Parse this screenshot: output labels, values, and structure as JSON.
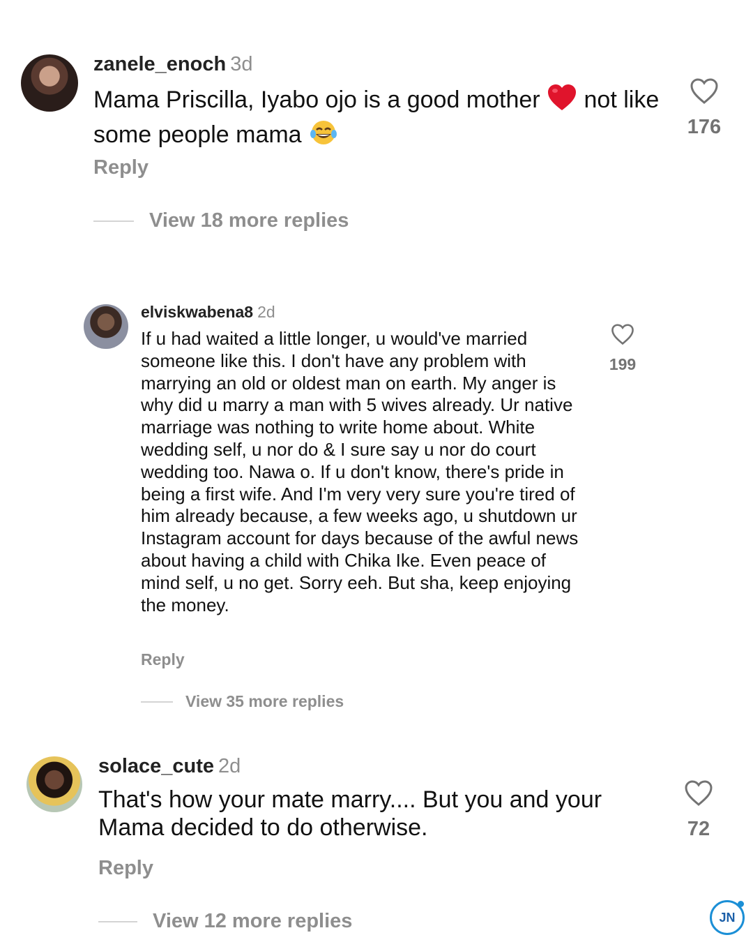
{
  "comments": [
    {
      "username": "zanele_enoch",
      "time": "3d",
      "text_before": "Mama Priscilla, Iyabo ojo is a good mother ",
      "text_after_heart": " not like some people mama ",
      "emoji_heart": "red-heart",
      "emoji_laugh": "tears-of-joy",
      "reply": "Reply",
      "likes": "176",
      "view_more": "View 18 more replies"
    },
    {
      "username": "elviskwabena8",
      "time": "2d",
      "text": "If u had waited a little longer, u would've married someone like this. I don't have any problem with marrying an old or oldest man on earth. My anger is why did u marry a man with 5 wives already. Ur native marriage was nothing to write home about. White wedding self, u nor do & I sure say u nor do court wedding too. Nawa o. If u don't know, there's pride in being a first wife. And I'm very very sure you're tired of him already because, a few weeks ago, u shutdown ur Instagram account for days because of the awful news about having a child with Chika Ike. Even peace of mind self, u no get. Sorry eeh. But sha, keep enjoying the money.",
      "reply": "Reply",
      "likes": "199",
      "view_more": "View 35 more replies"
    },
    {
      "username": "solace_cute",
      "time": "2d",
      "text": "That's how your mate marry.... But you and your Mama decided to do otherwise.",
      "reply": "Reply",
      "likes": "72",
      "view_more": "View 12 more replies"
    }
  ],
  "watermark": "JN",
  "colors": {
    "muted": "#8e8e8e",
    "heart_red": "#e0142c",
    "watermark_blue": "#1b8fd6"
  }
}
